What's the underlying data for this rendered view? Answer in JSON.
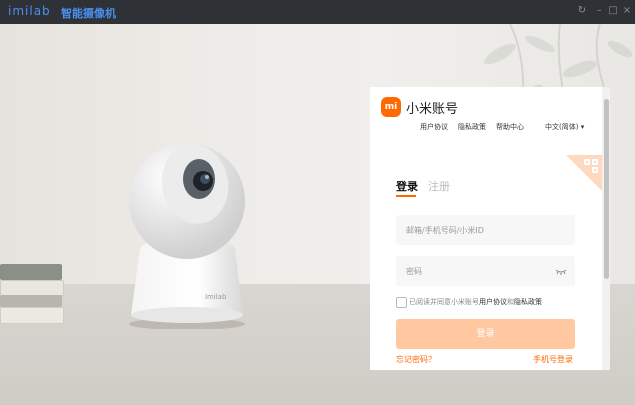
{
  "titlebar": {
    "brand": "imilab",
    "app_name": "智能摄像机",
    "restore_glyph": "↻",
    "minimize_glyph": "–",
    "maximize_glyph": "□",
    "close_glyph": "×"
  },
  "scene": {
    "camera_brand": "imilab"
  },
  "login_panel": {
    "logo_text": "mi",
    "title": "小米账号",
    "links": [
      "用户协议",
      "隐私政策",
      "帮助中心"
    ],
    "language": "中文(简体)",
    "language_chevron": "▾",
    "tabs": {
      "login": "登录",
      "register": "注册"
    },
    "account_placeholder": "邮箱/手机号码/小米ID",
    "password_placeholder": "密码",
    "agreement_prefix": "已阅读并同意小米账号",
    "agreement_terms": "用户协议",
    "agreement_and": "和",
    "agreement_privacy": "隐私政策",
    "login_button": "登录",
    "forgot_password": "忘记密码？",
    "phone_login": "手机号登录"
  },
  "colors": {
    "accent": "#ff6900",
    "button_disabled": "#ffc8a0",
    "titlebar_bg": "#2e3236",
    "brand_blue": "#4a8ff0"
  },
  "icons": [
    "qr-code-icon",
    "eye-closed-icon",
    "mi-logo-icon"
  ]
}
